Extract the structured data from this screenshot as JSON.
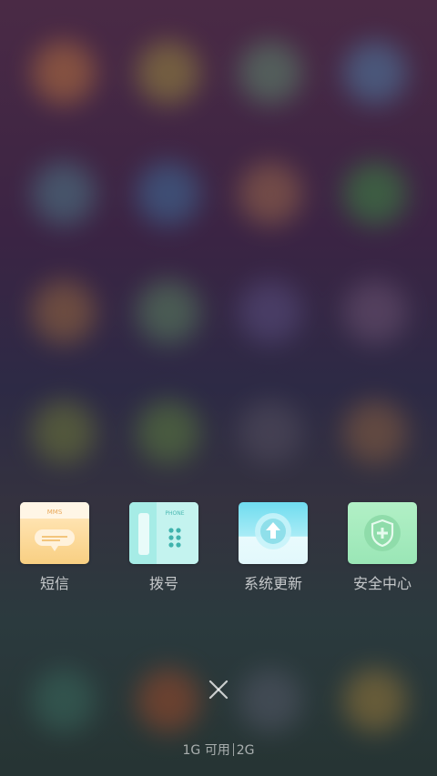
{
  "dock": {
    "apps": [
      {
        "label": "短信",
        "icon": "mms-icon",
        "icon_text": "MMS"
      },
      {
        "label": "拨号",
        "icon": "phone-icon",
        "icon_text": "PHONE"
      },
      {
        "label": "系统更新",
        "icon": "system-update-icon"
      },
      {
        "label": "安全中心",
        "icon": "security-center-icon"
      }
    ]
  },
  "close": {
    "icon": "close-icon"
  },
  "memory": {
    "available": "1G 可用",
    "total": "2G"
  },
  "colors": {
    "mms": "#f9d38c",
    "phone": "#8fe0dc",
    "update": "#8fe8f2",
    "security": "#a6ecc0"
  }
}
